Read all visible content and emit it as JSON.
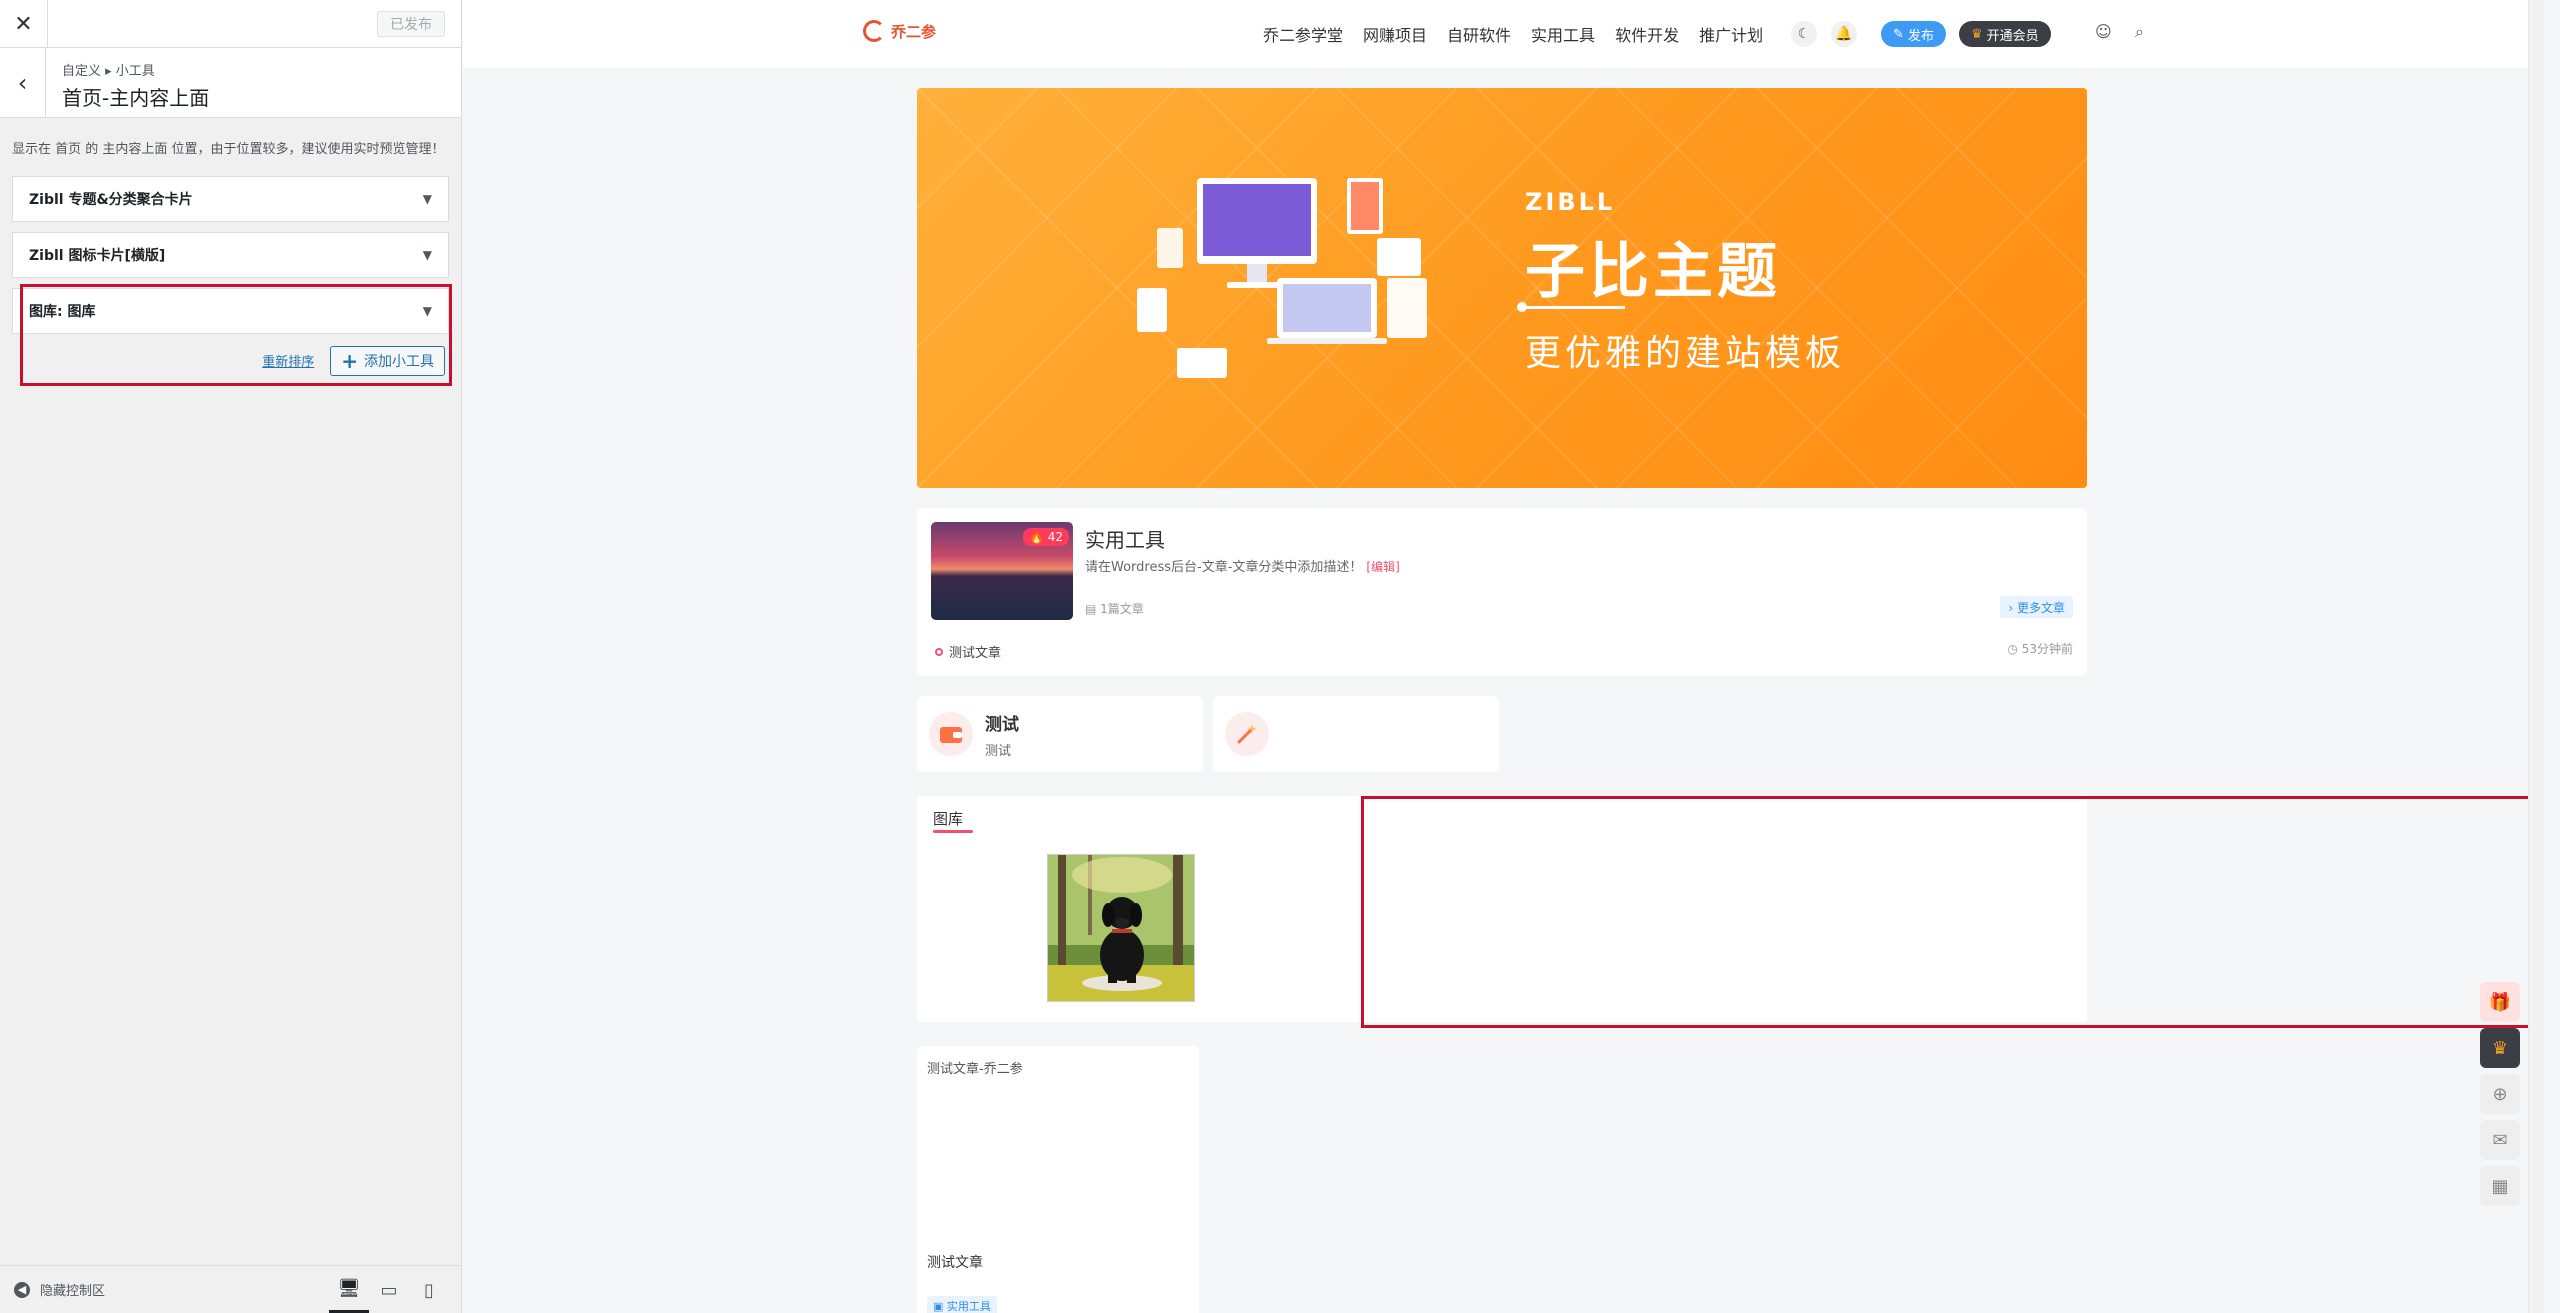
{
  "customizer": {
    "close_glyph": "✕",
    "publish_label": "已发布",
    "back_glyph": "‹",
    "breadcrumb": "自定义 ▸ 小工具",
    "section_title": "首页-主内容上面",
    "description": "显示在 首页 的 主内容上面 位置，由于位置较多，建议使用实时预览管理！",
    "widgets": [
      {
        "label": "Zibll 专题&分类聚合卡片"
      },
      {
        "label": "Zibll 图标卡片[横版]"
      },
      {
        "label": "图库: 图库"
      }
    ],
    "reorder_label": "重新排序",
    "add_widget_label": "添加小工具",
    "hide_controls_label": "隐藏控制区"
  },
  "header": {
    "logo_text": "乔二参",
    "nav": [
      "乔二参学堂",
      "网赚项目",
      "自研软件",
      "实用工具",
      "软件开发",
      "推广计划"
    ],
    "publish_label": "发布",
    "vip_label": "开通会员"
  },
  "banner": {
    "brand_small": "ZIBLL",
    "brand_big": "子比主题",
    "brand_sub": "更优雅的建站模板"
  },
  "category_card": {
    "badge": "42",
    "title": "实用工具",
    "description": "请在Wordress后台-文章-文章分类中添加描述！",
    "edit_label": "[编辑]",
    "count": "1篇文章",
    "more_label": "› 更多文章",
    "post_title": "测试文章",
    "post_time": "53分钟前"
  },
  "icon_cards": [
    {
      "title": "测试",
      "subtitle": "测试"
    },
    {
      "title": "",
      "subtitle": ""
    }
  ],
  "gallery": {
    "title": "图库"
  },
  "post_card": {
    "image_alt": "测试文章-乔二参",
    "title": "测试文章",
    "tag": "实用工具"
  },
  "colors": {
    "accent_red": "#c8102e",
    "banner_orange": "#ff9a1f",
    "link_blue": "#2271b1",
    "pink": "#f0506e"
  }
}
